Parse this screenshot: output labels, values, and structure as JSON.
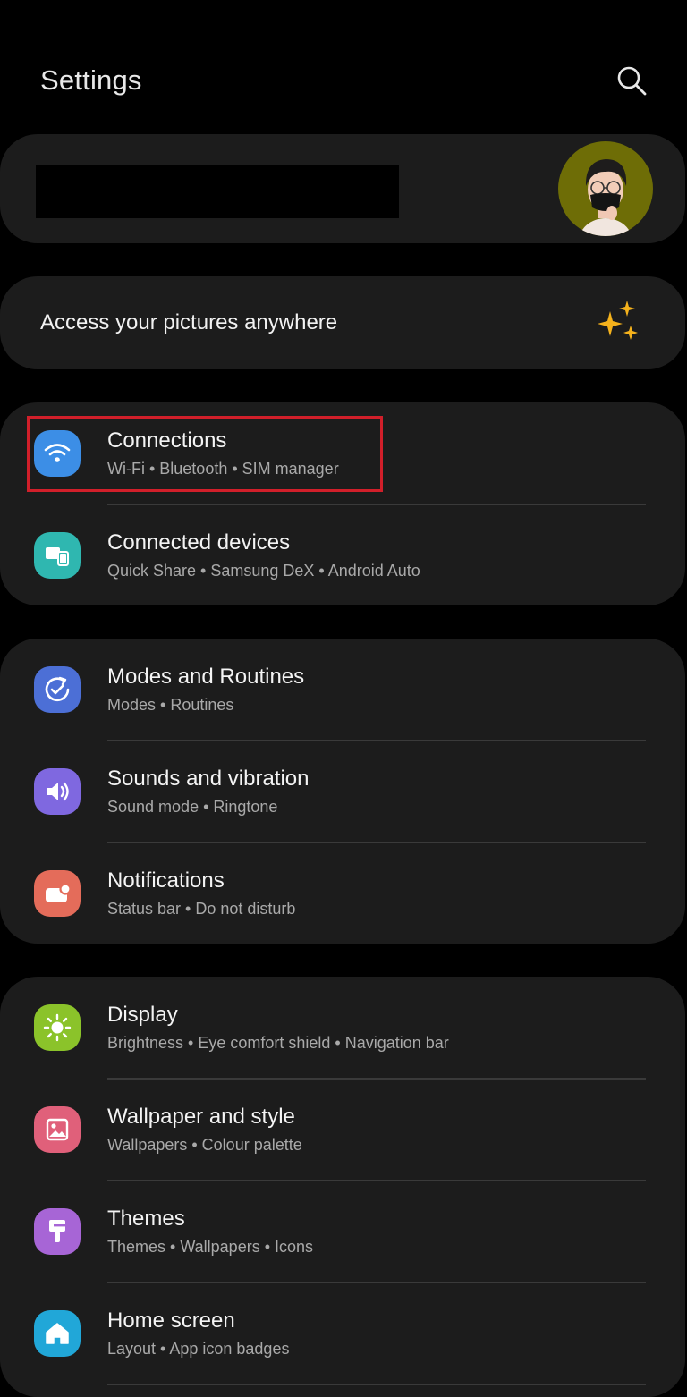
{
  "header": {
    "title": "Settings",
    "search_icon": "search-icon"
  },
  "profile": {
    "avatar_icon": "avatar"
  },
  "promo": {
    "text": "Access your pictures anywhere",
    "icon": "sparkle-icon",
    "icon_color": "#f5b21c"
  },
  "groups": [
    {
      "items": [
        {
          "title": "Connections",
          "subtitle": "Wi-Fi  •  Bluetooth  •  SIM manager",
          "icon": "wifi-icon",
          "color": "#3c8ee6"
        },
        {
          "title": "Connected devices",
          "subtitle": "Quick Share  •  Samsung DeX  •  Android Auto",
          "icon": "connected-devices-icon",
          "color": "#2fb7b0"
        }
      ]
    },
    {
      "items": [
        {
          "title": "Modes and Routines",
          "subtitle": "Modes  •  Routines",
          "icon": "modes-routines-icon",
          "color": "#4c6fd6"
        },
        {
          "title": "Sounds and vibration",
          "subtitle": "Sound mode  •  Ringtone",
          "icon": "speaker-icon",
          "color": "#7f68e0"
        },
        {
          "title": "Notifications",
          "subtitle": "Status bar  •  Do not disturb",
          "icon": "notification-icon",
          "color": "#e46c5a"
        }
      ]
    },
    {
      "items": [
        {
          "title": "Display",
          "subtitle": "Brightness  •  Eye comfort shield  •  Navigation bar",
          "icon": "sun-icon",
          "color": "#8bc32a"
        },
        {
          "title": "Wallpaper and style",
          "subtitle": "Wallpapers  •  Colour palette",
          "icon": "image-icon",
          "color": "#e0607a"
        },
        {
          "title": "Themes",
          "subtitle": "Themes  •  Wallpapers  •  Icons",
          "icon": "paintbrush-icon",
          "color": "#a765d6"
        },
        {
          "title": "Home screen",
          "subtitle": "Layout  •  App icon badges",
          "icon": "home-icon",
          "color": "#21a7d8"
        }
      ]
    }
  ],
  "highlight": {
    "target": "Connections",
    "color": "#d11f2a"
  }
}
